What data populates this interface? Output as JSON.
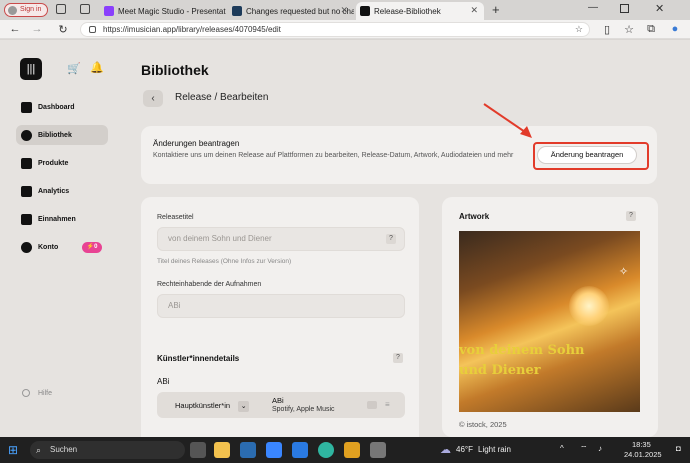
{
  "browser": {
    "signin": "Sign in",
    "tabs": [
      {
        "title": "Meet Magic Studio - Presentation"
      },
      {
        "title": "Changes requested but no chat h"
      },
      {
        "title": "Release-Bibliothek"
      }
    ],
    "url": "https://imusician.app/library/releases/4070945/edit"
  },
  "sidebar": {
    "items": [
      {
        "label": "Dashboard"
      },
      {
        "label": "Bibliothek"
      },
      {
        "label": "Produkte"
      },
      {
        "label": "Analytics"
      },
      {
        "label": "Einnahmen"
      },
      {
        "label": "Konto"
      }
    ],
    "konto_badge": "0",
    "help": "Hilfe"
  },
  "page": {
    "title": "Bibliothek",
    "subtitle": "Release / Bearbeiten"
  },
  "request": {
    "title": "Änderungen beantragen",
    "description": "Kontaktiere uns um deinen Release auf Plattformen zu bearbeiten, Release-Datum, Artwork, Audiodateien und mehr",
    "button": "Änderung beantragen"
  },
  "form": {
    "release_title_label": "Releasetitel",
    "release_title_value": "von deinem Sohn und Diener",
    "release_title_hint": "Titel deines Releases (Ohne Infos zur Version)",
    "rights_label": "Rechteinhabende der Aufnahmen",
    "rights_value": "ABi",
    "artists_section": "Künstler*innendetails",
    "artist_name": "ABi",
    "artist_role": "Hauptkünstler*in",
    "artist_display": "ABi",
    "artist_platforms": "Spotify, Apple Music",
    "qmark": "?"
  },
  "artwork": {
    "title": "Artwork",
    "image_text_line1": "von deinem Sohn",
    "image_text_line2": "und Diener",
    "credit": "© istock, 2025"
  },
  "taskbar": {
    "search": "Suchen",
    "weather_temp": "46°F",
    "weather_desc": "Light rain",
    "time": "18:35",
    "date": "24.01.2025"
  }
}
